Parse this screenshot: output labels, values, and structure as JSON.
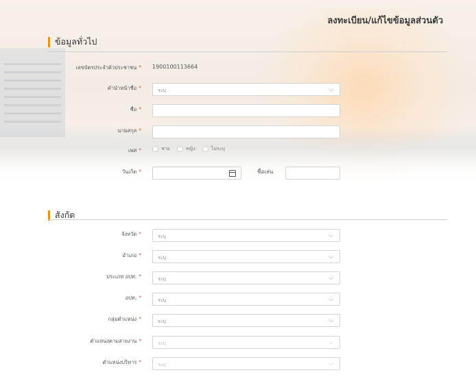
{
  "header": {
    "title": "ลงทะเบียน/แก้ไขข้อมูลส่วนตัว"
  },
  "sections": {
    "general": "ข้อมูลทั่วไป",
    "affiliation": "สังกัด"
  },
  "general": {
    "citizen_id": {
      "label": "เลขบัตรประจำตัวประชาชน",
      "value": "1900100113664"
    },
    "prefix": {
      "label": "คำนำหน้าชื่อ",
      "value": "ระบุ"
    },
    "first_name": {
      "label": "ชื่อ",
      "value": ""
    },
    "last_name": {
      "label": "นามสกุล",
      "value": ""
    },
    "gender": {
      "label": "เพศ",
      "options": [
        "ชาย",
        "หญิง",
        "ไม่ระบุ"
      ]
    },
    "birthdate": {
      "label": "วันเกิด",
      "value": ""
    },
    "nickname": {
      "label": "ชื่อเล่น",
      "value": ""
    }
  },
  "affiliation": {
    "fields": [
      {
        "label": "จังหวัด",
        "value": "ระบุ"
      },
      {
        "label": "อำเภอ",
        "value": "ระบุ"
      },
      {
        "label": "ประเภท อปท.",
        "value": "ระบุ"
      },
      {
        "label": "อปท.",
        "value": "ระบุ"
      },
      {
        "label": "กลุ่มตำแหน่ง",
        "value": "ระบุ"
      },
      {
        "label": "ตำแหน่งตามสายงาน",
        "value": "ระบุ"
      },
      {
        "label": "ตำแหน่งบริหาร",
        "value": "ระบุ"
      }
    ]
  },
  "colors": {
    "accent": "#f39200",
    "required": "#e05a3a"
  },
  "icons": {
    "dropdown": "chevron-down-icon",
    "calendar": "calendar-icon"
  }
}
